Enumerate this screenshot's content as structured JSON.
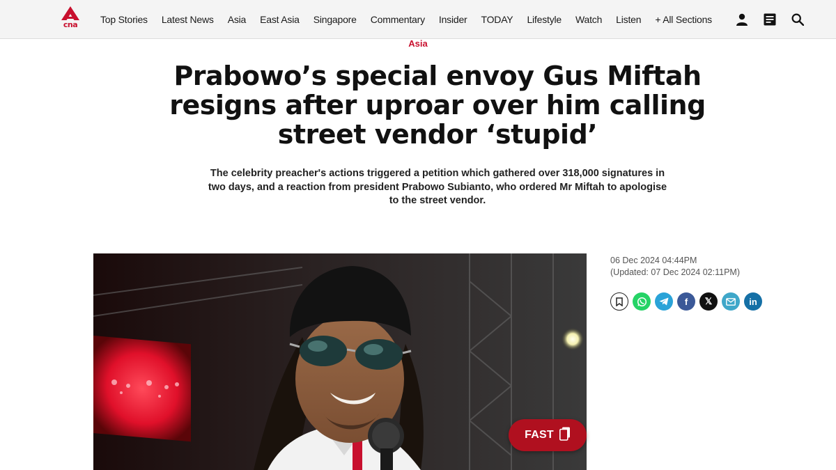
{
  "nav": {
    "logo_text": "cna",
    "links": [
      "Top Stories",
      "Latest News",
      "Asia",
      "East Asia",
      "Singapore",
      "Commentary",
      "Insider",
      "TODAY",
      "Lifestyle",
      "Watch",
      "Listen",
      "+ All Sections"
    ],
    "icons": [
      "user-icon",
      "newspaper-icon",
      "search-icon"
    ]
  },
  "article": {
    "section": "Asia",
    "headline": "Prabowo’s special envoy Gus Miftah resigns after uproar over him calling street vendor ‘stupid’",
    "summary": "The celebrity preacher's actions triggered a petition which gathered over 318,000 signatures in two days, and a reaction from president Prabowo Subianto, who ordered Mr Miftah to apologise to the street vendor.",
    "published": "06 Dec 2024 04:44PM",
    "updated": "(Updated: 07 Dec 2024 02:11PM)"
  },
  "fast_button": {
    "label": "FAST"
  },
  "share": {
    "icons": [
      "bookmark-icon",
      "whatsapp-icon",
      "telegram-icon",
      "facebook-icon",
      "x-icon",
      "email-icon",
      "linkedin-icon"
    ],
    "facebook_glyph": "f",
    "x_glyph": "𝕏",
    "linkedin_glyph": "in"
  },
  "colors": {
    "brand_red": "#c8102e",
    "fast_red": "#b0101f",
    "whatsapp": "#25d366",
    "telegram": "#2aa3d8",
    "facebook": "#3b5998",
    "linkedin": "#1570a6"
  }
}
